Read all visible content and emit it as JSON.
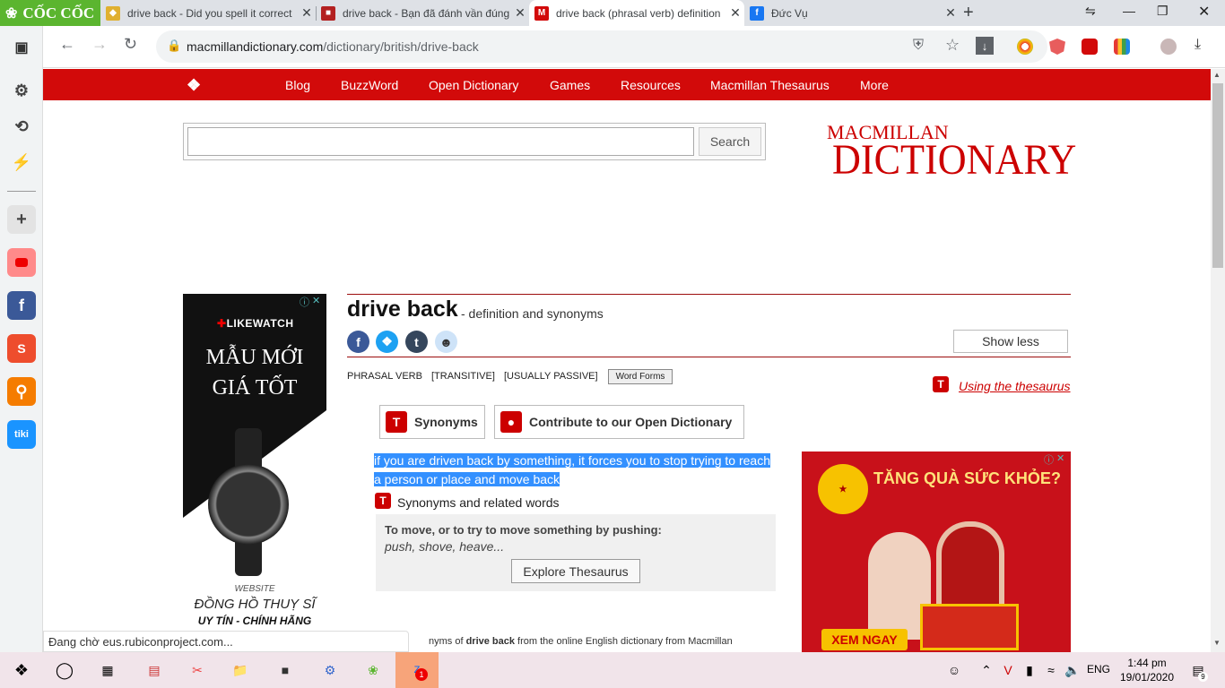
{
  "browser": {
    "brand": "CỐC CỐC",
    "tabs": [
      {
        "title": "drive back - Did you spell it correct",
        "active": false
      },
      {
        "title": "drive back - Bạn đã đánh vần đúng",
        "active": false
      },
      {
        "title": "drive back (phrasal verb) definition",
        "active": true
      },
      {
        "title": "Đức Vụ",
        "active": false
      }
    ],
    "url_host": "macmillandictionary.com",
    "url_path": "/dictionary/british/drive-back",
    "status_text": "Đang chờ eus.rubiconproject.com..."
  },
  "site": {
    "nav": [
      "Blog",
      "BuzzWord",
      "Open Dictionary",
      "Games",
      "Resources",
      "Macmillan Thesaurus",
      "More"
    ],
    "search_button": "Search",
    "search_placeholder": "",
    "logo_top": "MACMILLAN",
    "logo_bottom": "DICTIONARY"
  },
  "entry": {
    "headword": "drive back",
    "subtitle": "- definition and synonyms",
    "show_less": "Show less",
    "pos": "PHRASAL VERB",
    "gram1": "[TRANSITIVE]",
    "gram2": "[USUALLY PASSIVE]",
    "word_forms": "Word Forms",
    "using_thesaurus": "Using the thesaurus",
    "synonyms_btn": "Synonyms",
    "contribute_btn": "Contribute to our Open Dictionary",
    "definition_line1": "if you are driven back by something, it forces you to stop trying to reach",
    "definition_line2": "a person or place and move back",
    "synonyms_label": "Synonyms and related words",
    "thes_heading": "To move, or to try to move something by pushing:",
    "thes_words": "push, shove, heave...",
    "explore_btn": "Explore Thesaurus",
    "footer_pre": "nyms of ",
    "footer_bold": "drive back",
    "footer_post": " from the online English dictionary from Macmillan"
  },
  "ad_left": {
    "brand": "LIKEWATCH",
    "line1": "MẪU MỚI",
    "line2": "GIÁ TỐT",
    "small": "WEBSITE",
    "line3": "ĐỒNG HỒ THUỴ SĨ",
    "line4": "UY TÍN - CHÍNH HÃNG"
  },
  "ad_right": {
    "title": "TĂNG QUÀ SỨC KHỎE?",
    "button": "XEM NGAY"
  },
  "taskbar": {
    "lang": "ENG",
    "time": "1:44 pm",
    "date": "19/01/2020",
    "notif_count": "9"
  }
}
